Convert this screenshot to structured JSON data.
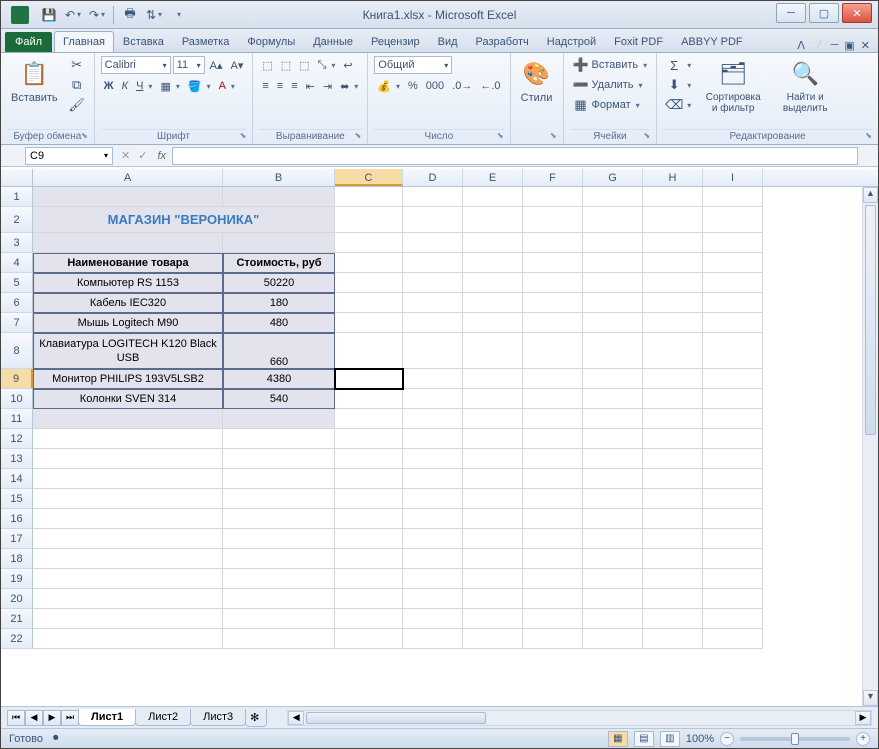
{
  "title": "Книга1.xlsx - Microsoft Excel",
  "qat": {
    "save": "💾",
    "undo": "↶",
    "redo": "↷",
    "print": "🖶",
    "sort": "⇅"
  },
  "tabs": {
    "file": "Файл",
    "items": [
      "Главная",
      "Вставка",
      "Разметка",
      "Формулы",
      "Данные",
      "Рецензир",
      "Вид",
      "Разработч",
      "Надстрой",
      "Foxit PDF",
      "ABBYY PDF"
    ],
    "active": 0
  },
  "ribbon": {
    "clipboard": {
      "paste": "Вставить",
      "label": "Буфер обмена"
    },
    "font": {
      "name": "Calibri",
      "size": "11",
      "label": "Шрифт"
    },
    "align": {
      "label": "Выравнивание"
    },
    "number": {
      "format": "Общий",
      "label": "Число"
    },
    "styles": {
      "btn": "Стили",
      "label": ""
    },
    "cells": {
      "insert": "Вставить",
      "delete": "Удалить",
      "format": "Формат",
      "label": "Ячейки"
    },
    "editing": {
      "sort": "Сортировка и фильтр",
      "find": "Найти и выделить",
      "label": "Редактирование"
    }
  },
  "namebox": "C9",
  "fx": "fx",
  "columns": [
    "A",
    "B",
    "C",
    "D",
    "E",
    "F",
    "G",
    "H",
    "I"
  ],
  "active_col": "C",
  "active_row": 9,
  "sheet": {
    "title": "МАГАЗИН \"ВЕРОНИКА\"",
    "headers": {
      "a": "Наименование товара",
      "b": "Стоимость, руб"
    },
    "rows": [
      {
        "name": "Компьютер RS 1153",
        "price": "50220"
      },
      {
        "name": "Кабель IEC320",
        "price": "180"
      },
      {
        "name": "Мышь  Logitech M90",
        "price": "480"
      },
      {
        "name": "Клавиатура LOGITECH K120 Black USB",
        "price": "660"
      },
      {
        "name": "Монитор PHILIPS 193V5LSB2",
        "price": "4380"
      },
      {
        "name": "Колонки  SVEN 314",
        "price": "540"
      }
    ]
  },
  "sheets": [
    "Лист1",
    "Лист2",
    "Лист3"
  ],
  "active_sheet": 0,
  "status": {
    "ready": "Готово",
    "zoom": "100%"
  }
}
